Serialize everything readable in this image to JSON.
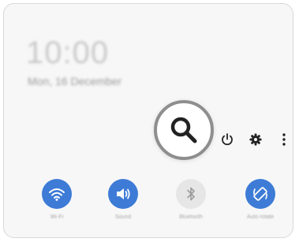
{
  "lock": {
    "time": "10:00",
    "date": "Mon, 16 December"
  },
  "top_icons": {
    "search": "search-icon",
    "power": "power-icon",
    "settings": "gear-icon",
    "more": "more-vertical-icon"
  },
  "quick_settings": [
    {
      "id": "wifi",
      "label": "Wi-Fi",
      "icon": "wifi-icon",
      "active": true
    },
    {
      "id": "sound",
      "label": "Sound",
      "icon": "sound-icon",
      "active": true
    },
    {
      "id": "bluetooth",
      "label": "Bluetooth",
      "icon": "bluetooth-icon",
      "active": false
    },
    {
      "id": "autorotate",
      "label": "Auto rotate",
      "icon": "auto-rotate-icon",
      "active": true
    }
  ],
  "colors": {
    "accent": "#3d7bd6",
    "inactive": "#e6e6e6",
    "panel": "#f7f7f7"
  }
}
